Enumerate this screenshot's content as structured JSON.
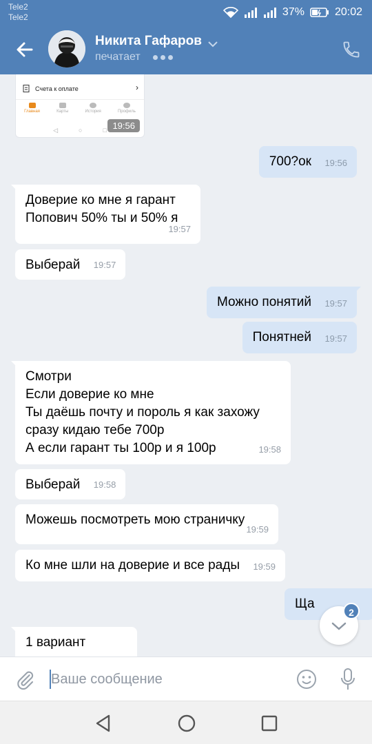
{
  "status_bar": {
    "carrier1": "Tele2",
    "carrier2": "Tele2",
    "battery": "37%",
    "time": "20:02"
  },
  "header": {
    "contact_name": "Никита Гафаров",
    "status": "печатает",
    "icons": [
      "back-arrow-icon",
      "chevron-down-icon",
      "phone-icon"
    ],
    "accent_color": "#5181b8"
  },
  "attachment": {
    "row_label": "Счета к оплате",
    "tabs": [
      "Главная",
      "Карты",
      "История",
      "Профиль"
    ],
    "time": "19:56"
  },
  "messages": [
    {
      "dir": "out",
      "text": "700?ок",
      "time": "19:56"
    },
    {
      "dir": "in",
      "text": "Доверие ко мне я гарант\nПопович 50% ты и 50% я",
      "time": "19:57"
    },
    {
      "dir": "in",
      "text": "Выберай",
      "time": "19:57"
    },
    {
      "dir": "out",
      "text": "Можно понятий",
      "time": "19:57"
    },
    {
      "dir": "out",
      "text": "Понятней",
      "time": "19:57"
    },
    {
      "dir": "in",
      "text": "Смотри\nЕсли доверие ко мне\nТы даёшь почту и пороль я как захожу\nсразу кидаю тебе 700р\nА если гарант ты 100р и я 100р",
      "time": "19:58"
    },
    {
      "dir": "in",
      "text": "Выберай",
      "time": "19:58"
    },
    {
      "dir": "in",
      "text": "Можешь посмотреть мою страничку",
      "time": "19:59"
    },
    {
      "dir": "in",
      "text": "Ко мне шли на доверие и все рады",
      "time": "19:59"
    },
    {
      "dir": "out",
      "text": "Ща",
      "time": ""
    },
    {
      "dir": "in",
      "text": "1 вариант",
      "time": ""
    }
  ],
  "scroll_down": {
    "unread_count": "2"
  },
  "composer": {
    "placeholder": "Ваше сообщение"
  }
}
